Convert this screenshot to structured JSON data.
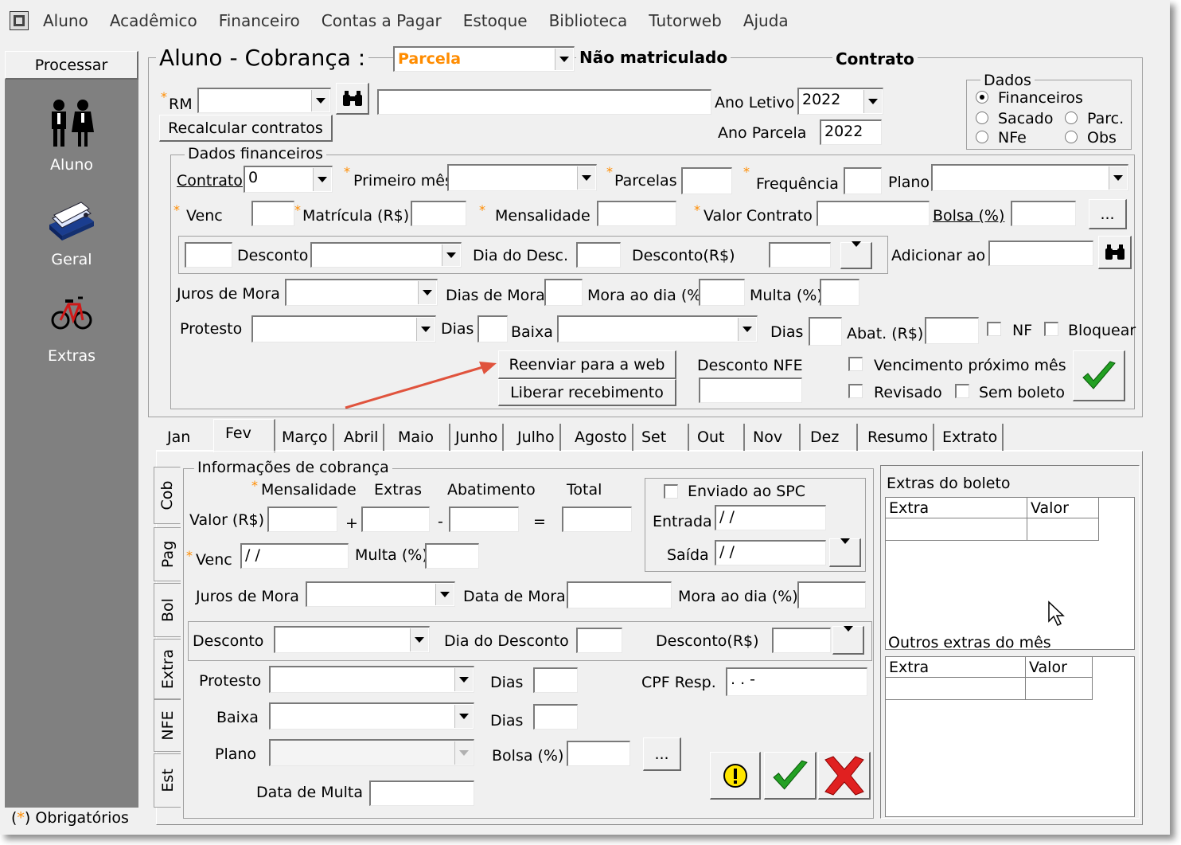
{
  "menu": [
    "Aluno",
    "Acadêmico",
    "Financeiro",
    "Contas a Pagar",
    "Estoque",
    "Biblioteca",
    "Tutorweb",
    "Ajuda"
  ],
  "sidebar": {
    "process_button": "Processar",
    "items": [
      {
        "label": "Aluno",
        "icon": "people-icon"
      },
      {
        "label": "Geral",
        "icon": "card-file-icon"
      },
      {
        "label": "Extras",
        "icon": "bicycle-icon"
      }
    ],
    "required_note": "Obrigatórios",
    "required_mark": "*"
  },
  "header": {
    "title": "Aluno  - Cobrança :",
    "type_value": "Parcela",
    "status": "Não matriculado",
    "contract_label": "Contrato"
  },
  "top": {
    "rm_label": "RM",
    "recalc_button": "Recalcular contratos",
    "ano_letivo_label": "Ano Letivo",
    "ano_letivo_value": "2022",
    "ano_parcela_label": "Ano Parcela",
    "ano_parcela_value": "2022",
    "dados": {
      "title": "Dados",
      "options": [
        "Financeiros",
        "Sacado",
        "Parc.",
        "NFe",
        "Obs"
      ],
      "selected": "Financeiros"
    }
  },
  "fin": {
    "title": "Dados financeiros",
    "contrato_label": "Contrato",
    "contrato_value": "0",
    "primeiro_mes_label": "Primeiro mês",
    "parcelas_label": "Parcelas",
    "frequencia_label": "Frequência",
    "plano_label": "Plano",
    "venc_label": "Venc",
    "matricula_label": "Matrícula (R$)",
    "mensalidade_label": "Mensalidade",
    "valor_contrato_label": "Valor Contrato",
    "bolsa_label": "Bolsa (%)",
    "ellipsis": "...",
    "desconto_label": "Desconto",
    "dia_desc_label": "Dia do Desc.",
    "desconto_rs_label": "Desconto(R$)",
    "adicionar_label": "Adicionar ao",
    "juros_label": "Juros de Mora",
    "dias_mora_label": "Dias de Mora",
    "mora_dia_label": "Mora ao dia (%)",
    "multa_label": "Multa (%)",
    "protesto_label": "Protesto",
    "dias_label": "Dias",
    "baixa_label": "Baixa",
    "abat_label": "Abat. (R$)",
    "nf_label": "NF",
    "bloquear_label": "Bloquear",
    "reenviar_button": "Reenviar para a web",
    "liberar_button": "Liberar recebimento",
    "desconto_nfe_label": "Desconto NFE",
    "venc_prox_label": "Vencimento próximo mês",
    "revisado_label": "Revisado",
    "sem_boleto_label": "Sem boleto"
  },
  "tabs": [
    "Jan",
    "Fev",
    "Março",
    "Abril",
    "Maio",
    "Junho",
    "Julho",
    "Agosto",
    "Set",
    "Out",
    "Nov",
    "Dez",
    "Resumo",
    "Extrato"
  ],
  "active_tab": "Fev",
  "vtabs": [
    "Cob",
    "Pag",
    "Bol",
    "Extra",
    "NFE",
    "Est"
  ],
  "cob": {
    "title": "Informações de cobrança",
    "mensalidade_hdr": "Mensalidade",
    "extras_hdr": "Extras",
    "abatimento_hdr": "Abatimento",
    "total_hdr": "Total",
    "valor_label": "Valor (R$)",
    "plus": "+",
    "minus": "-",
    "equals": "=",
    "venc_label": "Venc",
    "venc_value": " / /",
    "multa_label": "Multa (%)",
    "spc_label": "Enviado ao SPC",
    "entrada_label": "Entrada",
    "entrada_value": " / /",
    "saida_label": "Saída",
    "saida_value": " / /",
    "juros_label": "Juros de Mora",
    "data_mora_label": "Data de Mora",
    "mora_dia_label": "Mora ao dia (%)",
    "desconto_label": "Desconto",
    "dia_desconto_label": "Dia do Desconto",
    "desconto_rs_label": "Desconto(R$)",
    "protesto_label": "Protesto",
    "dias_label": "Dias",
    "cpf_label": "CPF Resp.",
    "cpf_value": " .  .  -",
    "baixa_label": "Baixa",
    "plano_label": "Plano",
    "bolsa_label": "Bolsa (%)",
    "ellipsis": "...",
    "data_multa_label": "Data de Multa"
  },
  "extras_boleto": {
    "title": "Extras do boleto",
    "cols": [
      "Extra",
      "Valor"
    ]
  },
  "outros_extras": {
    "title": "Outros extras do mês",
    "cols": [
      "Extra",
      "Valor"
    ]
  },
  "colors": {
    "window_bg": "#f0f0f0",
    "sidebar_bg": "#808080",
    "accent_orange": "#ff8c00",
    "check_green": "#22a022",
    "cross_red": "#e02020",
    "arrow_red": "#e0533d"
  }
}
